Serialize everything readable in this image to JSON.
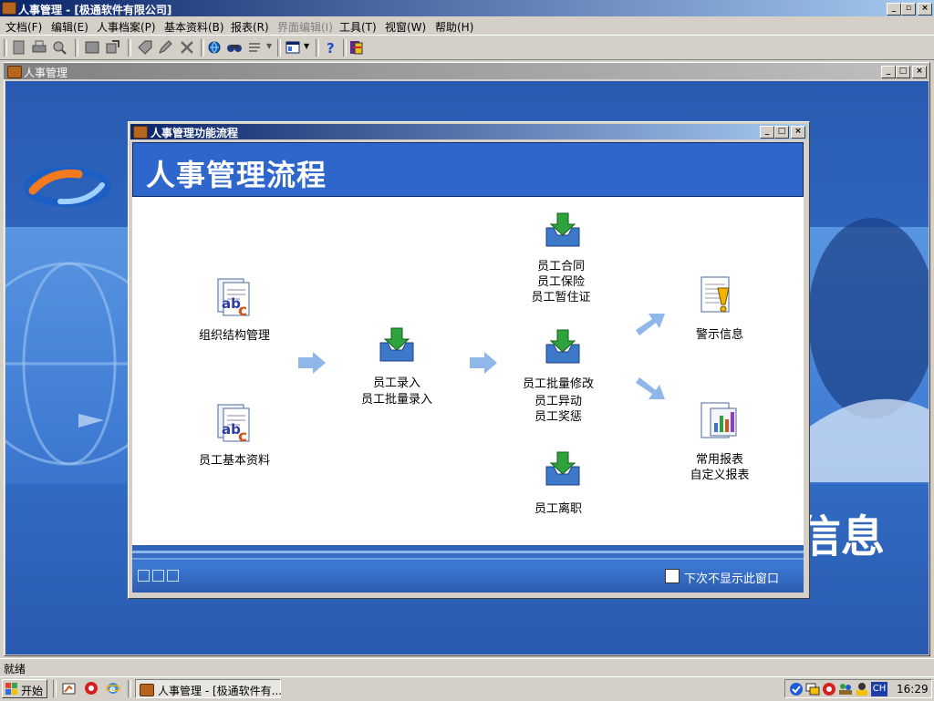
{
  "window": {
    "title": "人事管理 - [极通软件有限公司]"
  },
  "menu": [
    {
      "label": "文档(F)",
      "enabled": true
    },
    {
      "label": "编辑(E)",
      "enabled": true
    },
    {
      "label": "人事档案(P)",
      "enabled": true
    },
    {
      "label": "基本资料(B)",
      "enabled": true
    },
    {
      "label": "报表(R)",
      "enabled": true
    },
    {
      "label": "界面编辑(I)",
      "enabled": false
    },
    {
      "label": "工具(T)",
      "enabled": true
    },
    {
      "label": "视窗(W)",
      "enabled": true
    },
    {
      "label": "帮助(H)",
      "enabled": true
    }
  ],
  "toolbar": {
    "icons": [
      "new-icon",
      "print-icon",
      "preview-icon",
      "save-icon",
      "export-icon",
      "tag-icon",
      "edit-icon",
      "delete-icon",
      "globe-icon",
      "find-icon",
      "list-icon",
      "layout-icon",
      "help-icon",
      "exit-icon"
    ]
  },
  "mdi": {
    "title": "人事管理",
    "background_text": "信息"
  },
  "dialog": {
    "title": "人事管理功能流程",
    "banner": "人事管理流程",
    "nodes": {
      "org": "组织结构管理",
      "staff_basic": "员工基本资料",
      "entry_1": "员工录入",
      "entry_2": "员工批量录入",
      "contract_1": "员工合同",
      "contract_2": "员工保险",
      "contract_3": "员工暂住证",
      "modify_1": "员工批量修改",
      "modify_2": "员工异动",
      "modify_3": "员工奖惩",
      "leave": "员工离职",
      "warning": "警示信息",
      "report_1": "常用报表",
      "report_2": "自定义报表"
    },
    "checkbox_label": "下次不显示此窗口",
    "checkbox_checked": false
  },
  "status": {
    "text": "就绪"
  },
  "taskbar": {
    "start_label": "开始",
    "task_label": "人事管理 - [极通软件有...",
    "clock": "16:29",
    "ime": "CH"
  },
  "colors": {
    "titlebar": "#0a246a",
    "workspace": "#2f62b8",
    "banner": "#2e66cc"
  }
}
